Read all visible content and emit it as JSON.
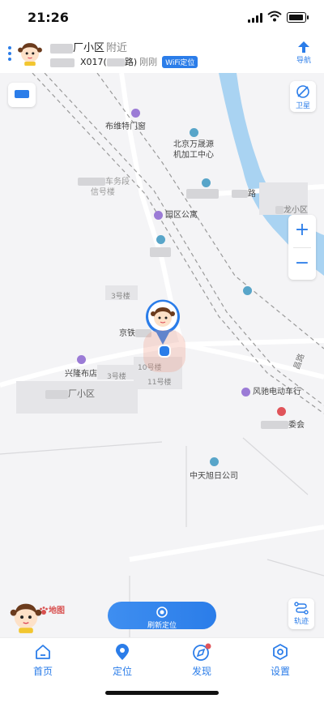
{
  "status_bar": {
    "time": "21:26"
  },
  "header": {
    "location_name": "厂小区",
    "location_suffix": "附近",
    "address_code": "X017(",
    "address_road": "路)",
    "time_label": "刚刚",
    "source_badge": "WiFi定位",
    "navigate_label": "导航"
  },
  "map": {
    "satellite_label": "卫星",
    "zoom_in": "+",
    "zoom_out": "−",
    "pois": {
      "buweite": "布维特门窗",
      "wanshengyuan_1": "北京万晟源",
      "wanshengyuan_2": "机加工中心",
      "chewu": "车务段",
      "xinhao": "信号楼",
      "yuanqu": "园区公寓",
      "road_end": "路",
      "long_xiaoqu": "龙小区",
      "jingtie": "京铁",
      "xinglong": "兴隆布店",
      "changxiaoqu": "厂小区",
      "fengchi": "风驰电动车行",
      "weihui": "委会",
      "zhongtian": "中天旭日公司",
      "changdao": "昌路"
    },
    "buildings": {
      "b3": "3号楼",
      "b10": "10号楼",
      "b3b": "3号楼",
      "b11": "11号楼"
    }
  },
  "actions": {
    "refresh_label": "刷新定位",
    "track_label": "轨迹",
    "baidu_logo": "地图"
  },
  "tabs": [
    {
      "label": "首页"
    },
    {
      "label": "定位"
    },
    {
      "label": "发现"
    },
    {
      "label": "设置"
    }
  ],
  "colors": {
    "accent": "#2b7de9",
    "river": "#a9d3f2",
    "poi_purple": "#9b7bd6",
    "poi_teal": "#58a5c9"
  }
}
